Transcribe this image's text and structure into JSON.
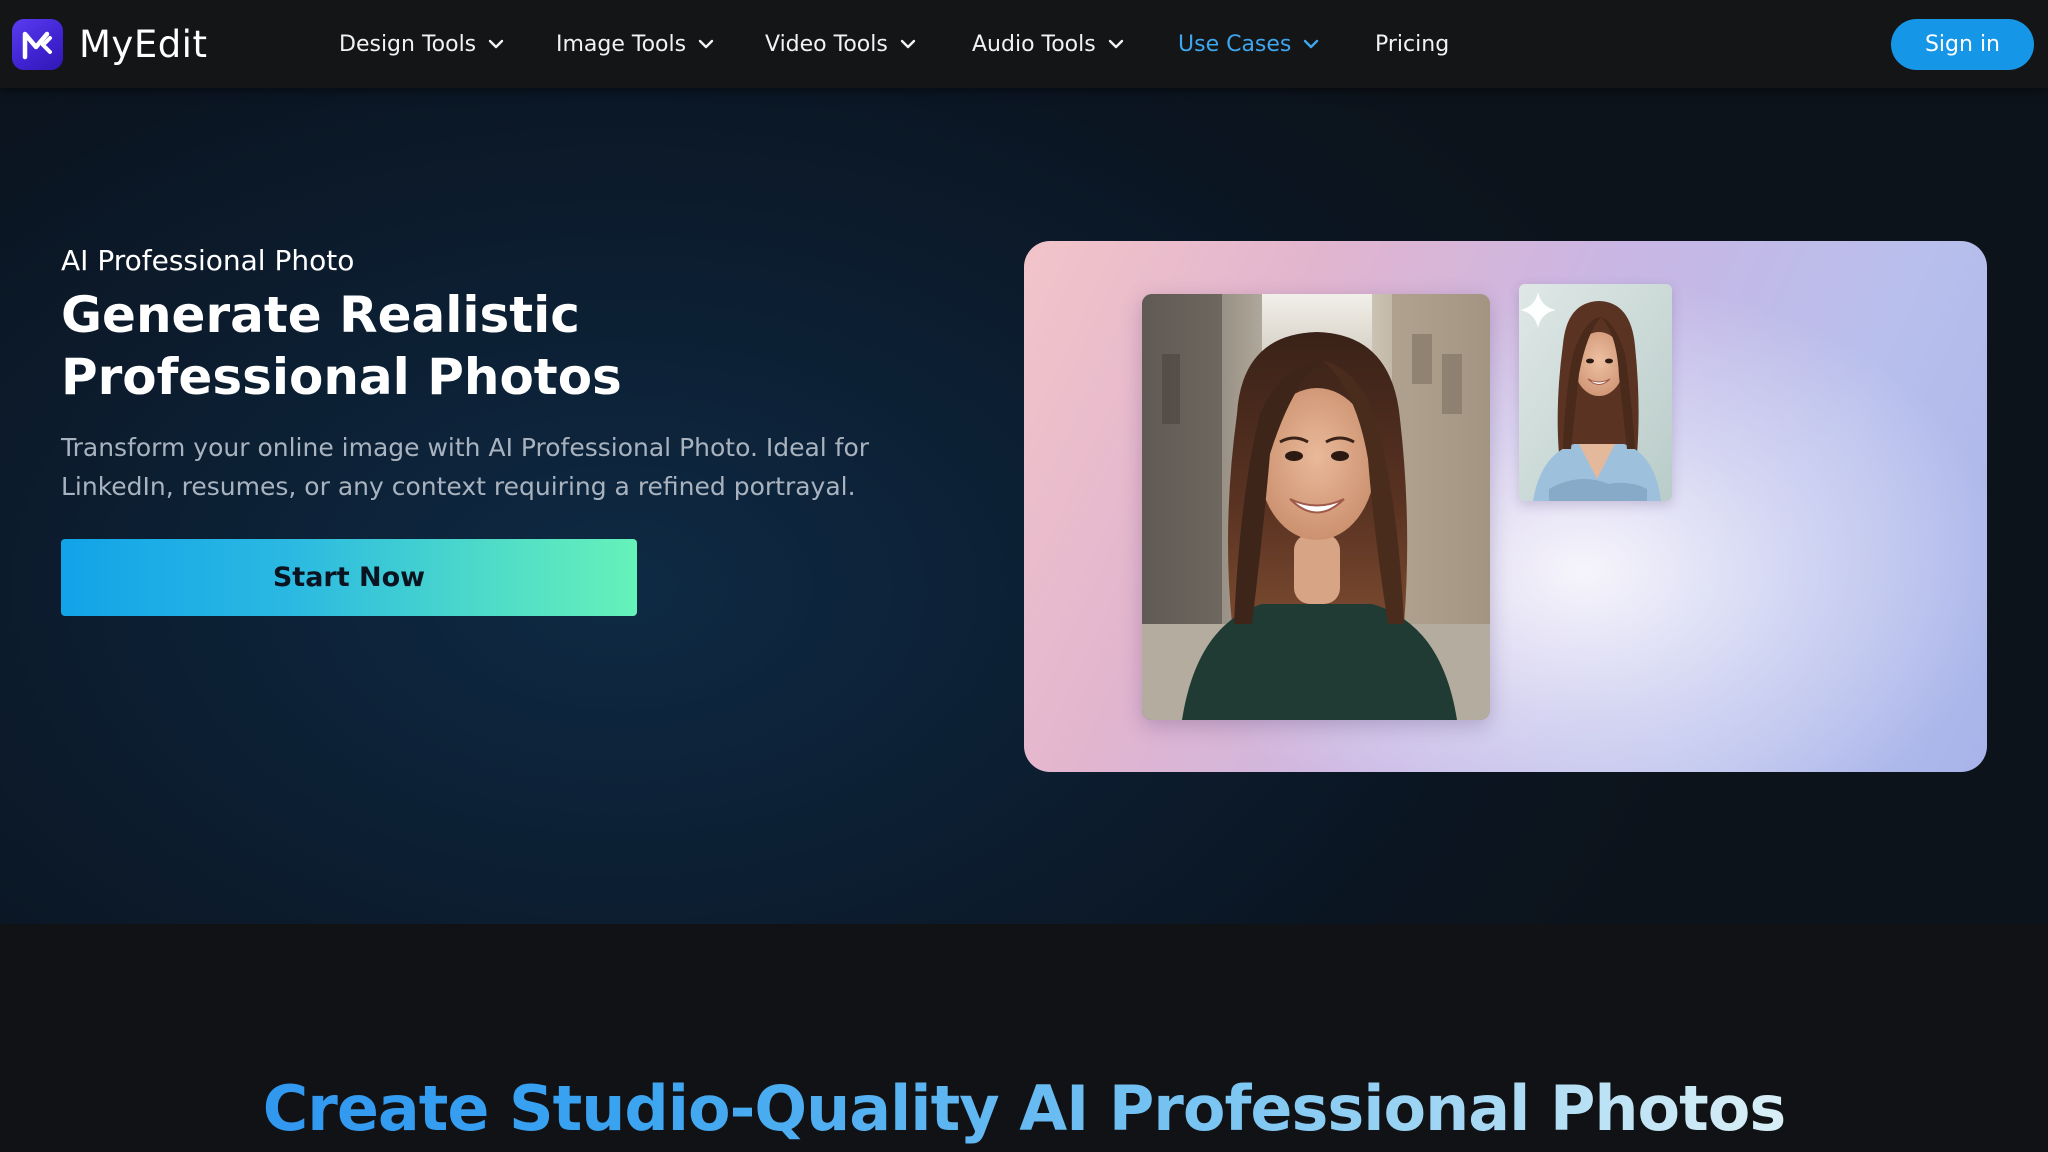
{
  "header": {
    "brand_name": "MyEdit",
    "nav": [
      {
        "label": "Design Tools",
        "has_dropdown": true
      },
      {
        "label": "Image Tools",
        "has_dropdown": true
      },
      {
        "label": "Video Tools",
        "has_dropdown": true
      },
      {
        "label": "Audio Tools",
        "has_dropdown": true
      },
      {
        "label": "Use Cases",
        "has_dropdown": true,
        "active": true
      },
      {
        "label": "Pricing",
        "has_dropdown": false
      }
    ],
    "sign_in_label": "Sign in"
  },
  "hero": {
    "eyebrow": "AI Professional Photo",
    "title": "Generate Realistic Professional Photos",
    "description": "Transform your online image with AI Professional Photo. Ideal for LinkedIn, resumes, or any context requiring a refined portrayal.",
    "cta_label": "Start Now"
  },
  "section2": {
    "title": "Create Studio-Quality AI Professional Photos"
  },
  "colors": {
    "accent_blue": "#1596e6",
    "active_nav": "#3ea6ee",
    "brand_purple": "#4a2ee0"
  },
  "icons": [
    "myedit-logo-icon",
    "chevron-down-icon",
    "sparkle-icon"
  ]
}
